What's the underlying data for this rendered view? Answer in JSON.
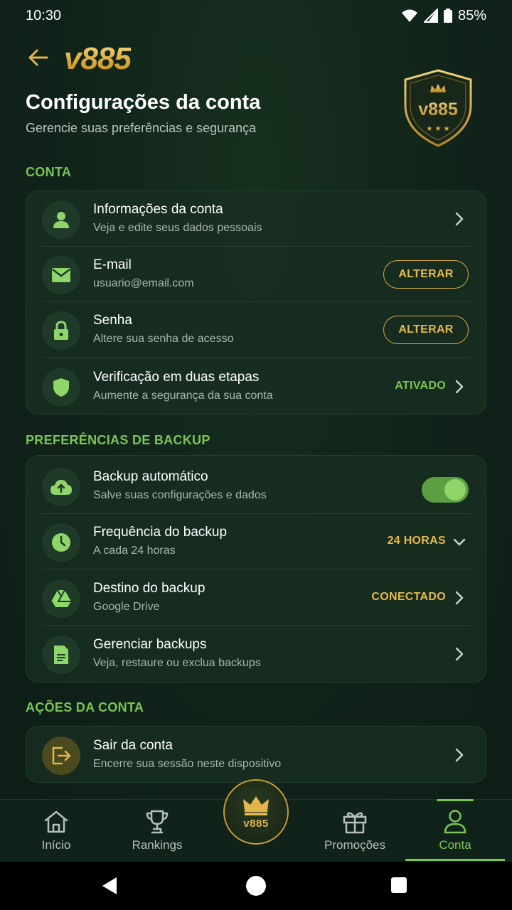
{
  "status_bar": {
    "time": "10:30",
    "battery": "85%"
  },
  "header": {
    "brand": "v885",
    "title": "Configurações da conta",
    "subtitle": "Gerencie suas preferências e segurança",
    "shield_text": "v885"
  },
  "sections": {
    "account": {
      "label": "CONTA",
      "rows": [
        {
          "title": "Informações da conta",
          "subtitle": "Veja e edite seus dados pessoais"
        },
        {
          "title": "E-mail",
          "subtitle": "usuario@email.com",
          "action": "ALTERAR"
        },
        {
          "title": "Senha",
          "subtitle": "Altere sua senha de acesso",
          "action": "ALTERAR"
        },
        {
          "title": "Verificação em duas etapas",
          "subtitle": "Aumente a segurança da sua conta",
          "status": "ATIVADO"
        }
      ]
    },
    "backup": {
      "label": "PREFERÊNCIAS DE BACKUP",
      "rows": [
        {
          "title": "Backup automático",
          "subtitle": "Salve suas configurações e dados",
          "toggle_on": true
        },
        {
          "title": "Frequência do backup",
          "subtitle": "A cada 24 horas",
          "value": "24 HORAS"
        },
        {
          "title": "Destino do backup",
          "subtitle": "Google Drive",
          "status": "CONECTADO"
        },
        {
          "title": "Gerenciar backups",
          "subtitle": "Veja, restaure ou exclua backups"
        }
      ]
    },
    "actions": {
      "label": "AÇÕES DA CONTA",
      "rows": [
        {
          "title": "Sair da conta",
          "subtitle": "Encerre sua sessão neste dispositivo"
        }
      ]
    }
  },
  "bottom_nav": {
    "items": [
      {
        "label": "Início",
        "icon": "home-icon"
      },
      {
        "label": "Rankings",
        "icon": "trophy-icon"
      },
      {
        "label": "v885",
        "icon": "crown-icon"
      },
      {
        "label": "Promoções",
        "icon": "gift-icon"
      },
      {
        "label": "Conta",
        "icon": "person-icon",
        "active": true
      }
    ]
  },
  "colors": {
    "background": "#10231a",
    "accent_green": "#7cc553",
    "accent_gold": "#e3b64b"
  }
}
